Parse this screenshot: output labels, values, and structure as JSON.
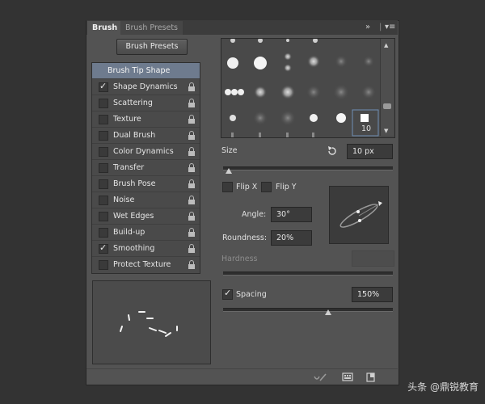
{
  "tabs": {
    "brush": "Brush",
    "presets": "Brush Presets"
  },
  "icons": {
    "collapse": "double-chevron-icon",
    "menu": "panel-menu-icon",
    "reset": "reset-size-icon"
  },
  "presets_button": "Brush Presets",
  "settings": [
    {
      "label": "Brush Tip Shape",
      "selected": true
    },
    {
      "label": "Shape Dynamics",
      "checked": true,
      "locked": true
    },
    {
      "label": "Scattering",
      "checked": false,
      "locked": true
    },
    {
      "label": "Texture",
      "checked": false,
      "locked": true
    },
    {
      "label": "Dual Brush",
      "checked": false,
      "locked": true
    },
    {
      "label": "Color Dynamics",
      "checked": false,
      "locked": true
    },
    {
      "label": "Transfer",
      "checked": false,
      "locked": true
    },
    {
      "label": "Brush Pose",
      "checked": false,
      "locked": true
    },
    {
      "label": "Noise",
      "checked": false,
      "locked": true
    },
    {
      "label": "Wet Edges",
      "checked": false,
      "locked": true
    },
    {
      "label": "Build-up",
      "checked": false,
      "locked": true
    },
    {
      "label": "Smoothing",
      "checked": true,
      "locked": true
    },
    {
      "label": "Protect Texture",
      "checked": false,
      "locked": true
    }
  ],
  "selected_tip": {
    "size_label": "10"
  },
  "size": {
    "label": "Size",
    "value": "10 px"
  },
  "flip_x": {
    "label": "Flip X",
    "checked": false
  },
  "flip_y": {
    "label": "Flip Y",
    "checked": false
  },
  "angle": {
    "label": "Angle:",
    "value": "30°"
  },
  "roundness": {
    "label": "Roundness:",
    "value": "20%"
  },
  "hardness": {
    "label": "Hardness"
  },
  "spacing": {
    "label": "Spacing",
    "checked": true,
    "value": "150%"
  },
  "watermark": "头条 @鼎锐教育"
}
